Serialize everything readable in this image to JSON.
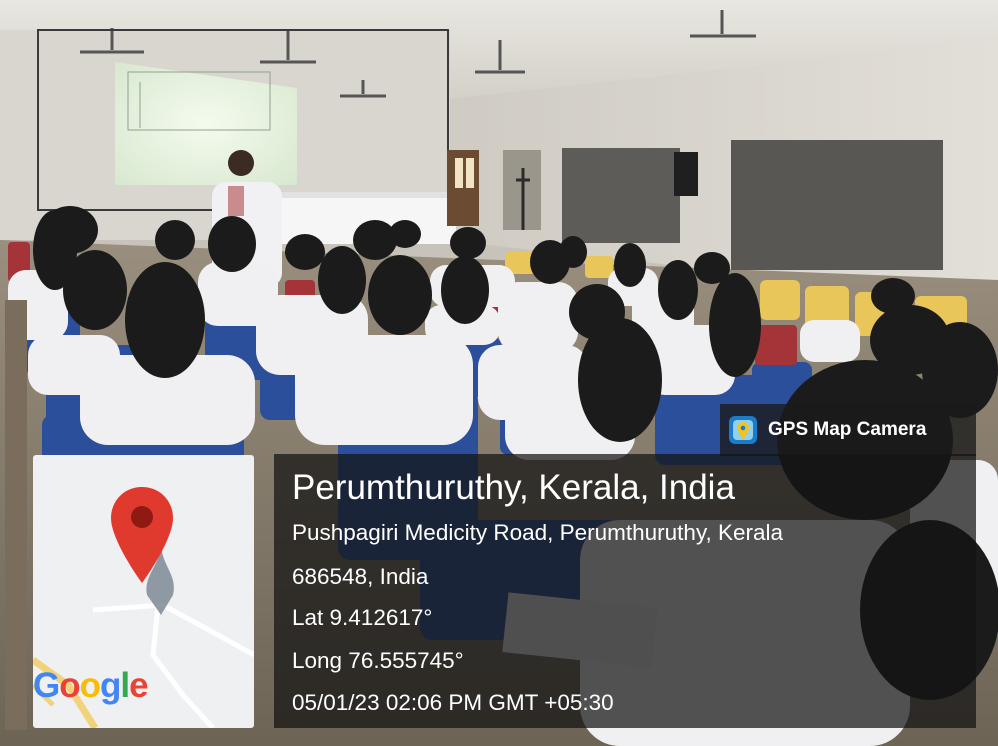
{
  "overlay": {
    "app_badge": {
      "icon": "gps-map-camera-icon",
      "label": "GPS Map Camera"
    },
    "location": {
      "title": "Perumthuruthy, Kerala, India",
      "address_line1": "Pushpagiri Medicity Road, Perumthuruthy, Kerala",
      "address_line2": "686548, India",
      "latitude": "Lat 9.412617°",
      "longitude": "Long 76.555745°",
      "datetime": "05/01/23 02:06 PM GMT +05:30"
    },
    "map_thumbnail": {
      "icon": "location-pin-icon",
      "logo_text": "Google",
      "logo_colors": [
        "#4285F4",
        "#EA4335",
        "#FBBC05",
        "#4285F4",
        "#34A853",
        "#EA4335"
      ]
    }
  },
  "scene": {
    "description_colors": {
      "wall": "#dcd9d2",
      "screen": "#eef4e6",
      "chair_blue": "#2c4f9c",
      "coat_white": "#f0f0f2",
      "hair_dark": "#1b1b1b"
    }
  }
}
